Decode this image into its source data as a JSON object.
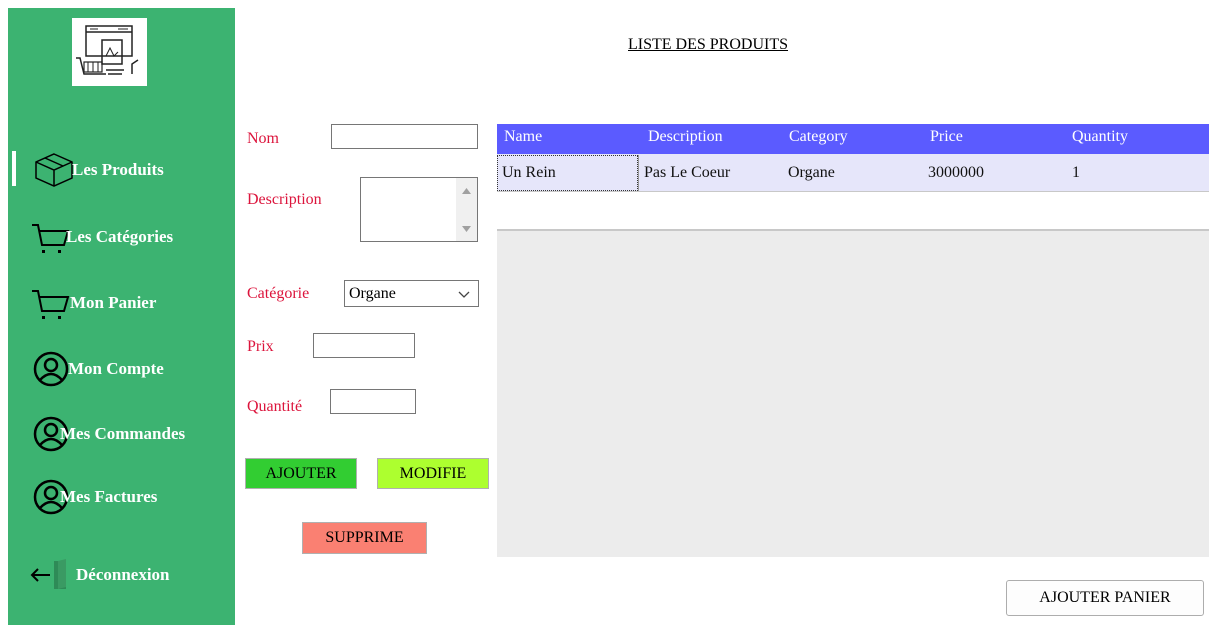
{
  "page": {
    "title": "LISTE DES PRODUITS"
  },
  "sidebar": {
    "items": [
      {
        "label": "Les Produits",
        "icon": "box-icon",
        "active": true
      },
      {
        "label": "Les Catégories",
        "icon": "cart-icon"
      },
      {
        "label": "Mon Panier",
        "icon": "cart-icon"
      },
      {
        "label": "Mon Compte",
        "icon": "user-icon"
      },
      {
        "label": "Mes Commandes",
        "icon": "user-icon"
      },
      {
        "label": "Mes Factures",
        "icon": "user-icon"
      },
      {
        "label": "Déconnexion",
        "icon": "logout-icon"
      }
    ]
  },
  "form": {
    "nom_label": "Nom",
    "nom_value": "",
    "description_label": "Description",
    "description_value": "",
    "categorie_label": "Catégorie",
    "categorie_value": "Organe",
    "prix_label": "Prix",
    "prix_value": "",
    "quantite_label": "Quantité",
    "quantite_value": ""
  },
  "buttons": {
    "ajouter": "AJOUTER",
    "modifie": "MODIFIE",
    "supprime": "SUPPRIME",
    "ajouter_panier": "AJOUTER PANIER"
  },
  "table": {
    "columns": [
      "Name",
      "Description",
      "Category",
      "Price",
      "Quantity"
    ],
    "rows": [
      [
        "Un Rein",
        "Pas Le Coeur",
        "Organe",
        "3000000",
        "1"
      ]
    ]
  },
  "colors": {
    "sidebar": "#3cb371",
    "label": "#dc143c",
    "header": "#5b5bff",
    "ajouter": "#32cd32",
    "modifie": "#adff2f",
    "supprime": "#fa8072"
  }
}
